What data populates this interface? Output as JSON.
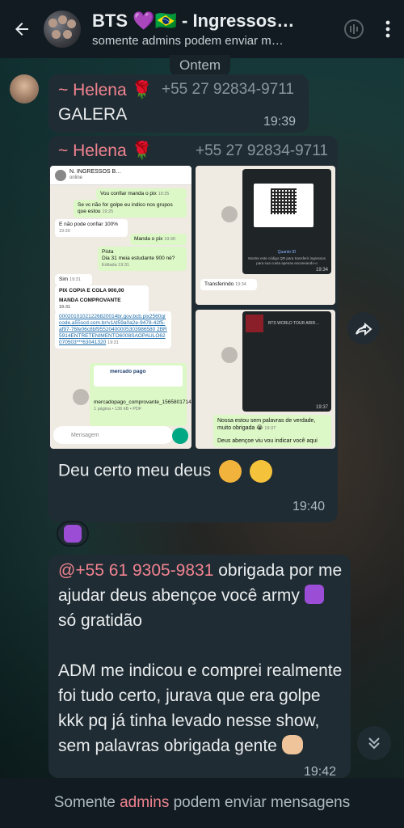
{
  "header": {
    "title": "BTS 💜🇧🇷 - Ingressos…",
    "subtitle": "somente admins podem enviar m…"
  },
  "date_chip": "Ontem",
  "message1": {
    "sender": "~ Helena 🌹",
    "phone": "+55 27 92834-9711",
    "text": "GALERA",
    "time": "19:39"
  },
  "message2": {
    "sender": "~ Helena 🌹",
    "phone": "+55 27 92834-9711",
    "caption": "Deu certo meu deus",
    "time": "19:40",
    "screenshot_left": {
      "chat_name": "N. INGRESSOS B…",
      "chat_status": "online",
      "m1": "Vou confiar manda o pix",
      "m1_time": "19:25",
      "m2": "Se vc não for golpe eu indico nos grupos que estou",
      "m2_time": "19:25",
      "m3": "E não pode confiar 100%",
      "m3_time": "19:30",
      "m4": "Manda o pix",
      "m4_time": "19:30",
      "m5a": "Pista",
      "m5b": "Dia 31 meia estudante 900 né?",
      "m5_time": "Editada 19:31",
      "m6": "Sim",
      "m6_time": "19:31",
      "m7a": "PIX COPIA E COLA 900,00",
      "m7b": "MANDA COMPROVANTE",
      "m7_time": "19:31",
      "m8": "00020101021226820014br.gov.bcb.pix2560qrcode.a55scd.com.br/v1/d59a0a2e-9478-42f5-af97-76fe06c8bf95520400005303986580 2BR5914ENTRETENIMENTO6008SAOPAULO62070503***63041320",
      "m8_time": "19:31",
      "doc_name": "mercadopago_comprovante_1565801714.pdf",
      "doc_meta": "1 página • 136 kB • PDF",
      "mp_brand": "mercado pago",
      "input_placeholder": "Mensagem"
    },
    "screenshot_right_top": {
      "qr_label": "Quanto ID",
      "qr_note": "Mostre este código QR para transferir ingressos para sua conta apenas escaneando-o",
      "time1": "19:34",
      "transfer_text": "Transferindo",
      "time2": "19:34"
    },
    "screenshot_right_bottom": {
      "event_name": "BTS WORLD TOUR ARIR…",
      "time1": "19:37",
      "msg": "Nossa estou sem palavras de verdade, muito obrigada 😭",
      "time2": "19:37",
      "msg2": "Deus abençoe viu vou indicar você aqui"
    }
  },
  "reaction": "💜",
  "message3": {
    "mention": "@+55 61 9305-9831",
    "text_a": "obrigada por me ajudar deus abençoe você army",
    "text_b": "só gratidão",
    "text_c": "ADM me indicou e comprei realmente foi tudo certo, jurava que era golpe kkk pq já tinha levado nesse show, sem palavras obrigada gente",
    "time": "19:42"
  },
  "bottom": {
    "pre": "Somente ",
    "admins": "admins",
    "post": " podem enviar mensagens"
  }
}
